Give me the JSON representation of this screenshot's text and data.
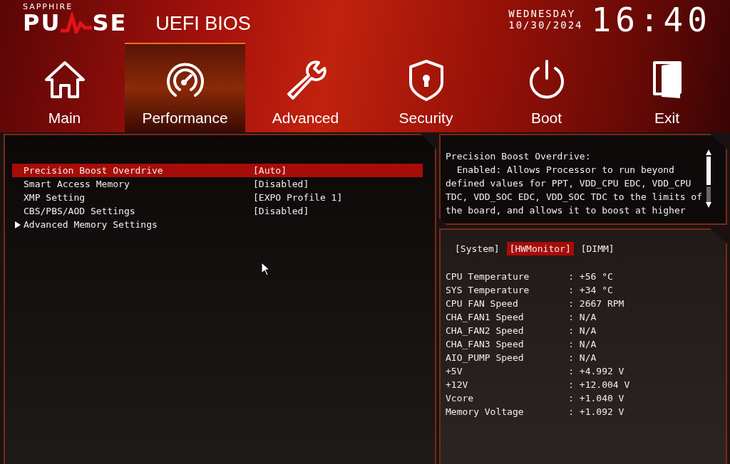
{
  "header": {
    "brand_top": "SAPPHIRE",
    "brand_left": "PU",
    "brand_right": "SE",
    "product": "UEFI BIOS",
    "day": "WEDNESDAY",
    "date": "10/30/2024",
    "time": "16:40"
  },
  "tabs": [
    {
      "label": "Main",
      "selected": false
    },
    {
      "label": "Performance",
      "selected": true
    },
    {
      "label": "Advanced",
      "selected": false
    },
    {
      "label": "Security",
      "selected": false
    },
    {
      "label": "Boot",
      "selected": false
    },
    {
      "label": "Exit",
      "selected": false
    }
  ],
  "settings": [
    {
      "label": "Precision Boost Overdrive",
      "value": "[Auto]",
      "selected": true,
      "kind": "option"
    },
    {
      "label": "Smart Access Memory",
      "value": "[Disabled]",
      "selected": false,
      "kind": "option"
    },
    {
      "label": "XMP Setting",
      "value": "[EXPO Profile 1]",
      "selected": false,
      "kind": "option"
    },
    {
      "label": "CBS/PBS/AOD Settings",
      "value": "[Disabled]",
      "selected": false,
      "kind": "option"
    },
    {
      "label": "Advanced Memory Settings",
      "selected": false,
      "kind": "submenu"
    }
  ],
  "help": {
    "title": "Precision Boost Overdrive:",
    "text": "  Enabled: Allows Processor to run beyond defined values for PPT, VDD_CPU EDC, VDD_CPU TDC, VDD_SOC EDC, VDD_SOC TDC to the limits of the board, and allows it to boost at higher"
  },
  "monitor_tabs": [
    {
      "label": "[System]",
      "selected": false
    },
    {
      "label": "[HWMonitor]",
      "selected": true
    },
    {
      "label": "[DIMM]",
      "selected": false
    }
  ],
  "monitor": [
    {
      "label": "CPU Temperature",
      "value": ": +56 °C"
    },
    {
      "label": "SYS Temperature",
      "value": ": +34 °C"
    },
    {
      "label": "CPU FAN Speed",
      "value": ": 2667 RPM"
    },
    {
      "label": "CHA_FAN1 Speed",
      "value": ": N/A"
    },
    {
      "label": "CHA_FAN2 Speed",
      "value": ": N/A"
    },
    {
      "label": "CHA_FAN3 Speed",
      "value": ": N/A"
    },
    {
      "label": "AIO_PUMP Speed",
      "value": ": N/A"
    },
    {
      "label": "+5V",
      "value": ": +4.992 V"
    },
    {
      "label": "+12V",
      "value": ": +12.004 V"
    },
    {
      "label": "Vcore",
      "value": ": +1.040 V"
    },
    {
      "label": "Memory Voltage",
      "value": ": +1.092 V"
    }
  ]
}
